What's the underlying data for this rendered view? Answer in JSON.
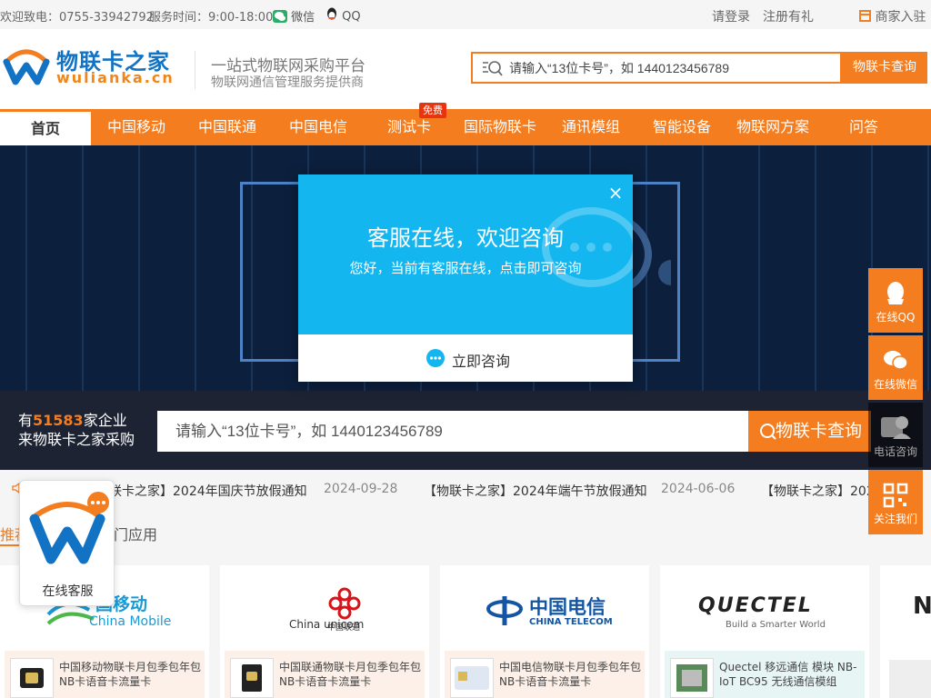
{
  "topbar": {
    "hotline": "欢迎致电：0755-33942792",
    "hours": "服务时间：9:00-18:00",
    "wechat": "微信",
    "qq": "QQ",
    "login": "请登录",
    "register": "注册有礼",
    "merchant": "商家入驻"
  },
  "header": {
    "logo_cn": "物联卡之家",
    "logo_en": "wulianka.cn",
    "slogan1": "一站式物联网采购平台",
    "slogan2": "物联网通信管理服务提供商",
    "search_placeholder": "请输入“13位卡号”，如 1440123456789",
    "search_button": "物联卡查询"
  },
  "nav": {
    "items": [
      "首页",
      "中国移动",
      "中国联通",
      "中国电信",
      "测试卡",
      "国际物联卡",
      "通讯模组",
      "智能设备",
      "物联网方案",
      "问答"
    ],
    "free_badge": "免费"
  },
  "query": {
    "prefix": "有",
    "count": "51583",
    "suffix": "家企业",
    "line2": "来物联卡之家采购",
    "placeholder": "请输入“13位卡号”，如 1440123456789",
    "button": "物联卡查询"
  },
  "notices": [
    {
      "title": "联卡之家】2024年国庆节放假通知",
      "date": "2024-09-28"
    },
    {
      "title": "【物联卡之家】2024年端午节放假通知",
      "date": "2024-06-06"
    },
    {
      "title": "【物联卡之家】202",
      "date": ""
    }
  ],
  "tabs": {
    "first": "推荐",
    "second": "门应用"
  },
  "cards": [
    {
      "logo_cn": "国移动",
      "logo_en": "China Mobile",
      "product": "中国移动物联卡月包季包年包NB卡语音卡流量卡"
    },
    {
      "logo_cn": "中国联通",
      "logo_en": "China unicom",
      "product": "中国联通物联卡月包季包年包NB卡语音卡流量卡"
    },
    {
      "logo_cn": "中国电信",
      "logo_en": "CHINA TELECOM",
      "product": "中国电信物联卡月包季包年包NB卡语音卡流量卡"
    },
    {
      "logo_cn": "QUECTEL",
      "logo_en": "Build a Smarter World",
      "product": "Quectel 移远通信 模块 NB-IoT BC95 无线通信模组"
    }
  ],
  "card5_letter": "N",
  "right_panel": [
    "在线QQ",
    "在线微信",
    "电话咨询",
    "关注我们"
  ],
  "kefu_label": "在线客服",
  "modal": {
    "title": "客服在线，欢迎咨询",
    "subtitle": "您好，当前有客服在线，点击即可咨询",
    "button": "立即咨询",
    "close": "×"
  },
  "colors": {
    "brand_orange": "#f47d20",
    "brand_blue": "#1273c4",
    "modal_blue": "#14b6f0"
  }
}
